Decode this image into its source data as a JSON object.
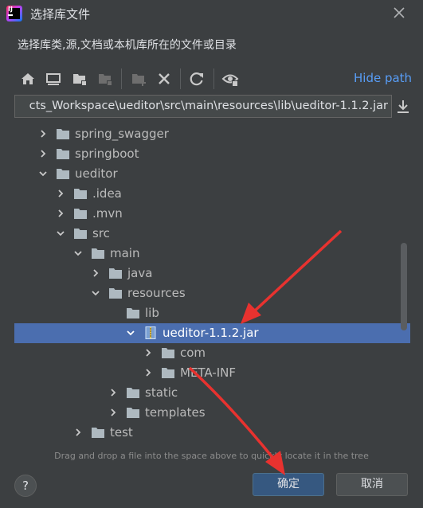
{
  "window": {
    "title": "选择库文件",
    "description": "选择库类,源,文档或本机库所在的文件或目录"
  },
  "toolbar": {
    "hide_path_label": "Hide path",
    "icons": [
      "home-icon",
      "desktop-icon",
      "project-folder-icon",
      "module-folder-icon",
      "new-folder-icon",
      "delete-icon",
      "refresh-icon",
      "show-hidden-icon"
    ]
  },
  "path": {
    "value": "cts_Workspace\\ueditor\\src\\main\\resources\\lib\\ueditor-1.1.2.jar"
  },
  "tree": {
    "items": [
      {
        "label": "spring_swagger",
        "depth": 0,
        "expanded": false,
        "type": "folder"
      },
      {
        "label": "springboot",
        "depth": 0,
        "expanded": false,
        "type": "folder"
      },
      {
        "label": "ueditor",
        "depth": 0,
        "expanded": true,
        "type": "folder"
      },
      {
        "label": ".idea",
        "depth": 1,
        "expanded": false,
        "type": "folder"
      },
      {
        "label": ".mvn",
        "depth": 1,
        "expanded": false,
        "type": "folder"
      },
      {
        "label": "src",
        "depth": 1,
        "expanded": true,
        "type": "folder"
      },
      {
        "label": "main",
        "depth": 2,
        "expanded": true,
        "type": "folder"
      },
      {
        "label": "java",
        "depth": 3,
        "expanded": false,
        "type": "folder"
      },
      {
        "label": "resources",
        "depth": 3,
        "expanded": true,
        "type": "folder"
      },
      {
        "label": "lib",
        "depth": 4,
        "expanded": true,
        "type": "folder",
        "no_arrow": true
      },
      {
        "label": "ueditor-1.1.2.jar",
        "depth": 5,
        "expanded": true,
        "type": "jar",
        "selected": true
      },
      {
        "label": "com",
        "depth": 6,
        "expanded": false,
        "type": "folder"
      },
      {
        "label": "META-INF",
        "depth": 6,
        "expanded": false,
        "type": "folder"
      },
      {
        "label": "static",
        "depth": 4,
        "expanded": false,
        "type": "folder"
      },
      {
        "label": "templates",
        "depth": 4,
        "expanded": false,
        "type": "folder"
      },
      {
        "label": "test",
        "depth": 2,
        "expanded": false,
        "type": "folder"
      }
    ]
  },
  "hint": "Drag and drop a file into the space above to quickly locate it in the tree",
  "buttons": {
    "help_label": "?",
    "ok_label": "确定",
    "cancel_label": "取消"
  },
  "colors": {
    "background": "#3c3f41",
    "selection": "#4b6eaf",
    "link": "#589df6",
    "annotation_arrow": "#e8322f"
  }
}
